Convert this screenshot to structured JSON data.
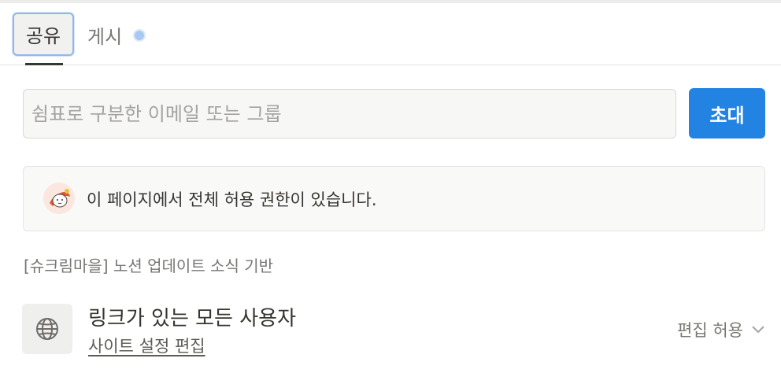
{
  "tabs": {
    "share_label": "공유",
    "publish_label": "게시",
    "publish_status_icon": "dot-icon"
  },
  "invite": {
    "placeholder": "쉼표로 구분한 이메일 또는 그룹",
    "value": "",
    "button_label": "초대"
  },
  "permission_notice": {
    "avatar_icon": "avatar-illustration",
    "text": "이 페이지에서 전체 허용 권한이 있습니다."
  },
  "workspace": {
    "name": "[슈크림마을] 노션 업데이트 소식 기반"
  },
  "link_access": {
    "icon": "globe-icon",
    "title": "링크가 있는 모든 사용자",
    "settings_link": "사이트 설정 편집",
    "permission_value": "편집 허용",
    "dropdown_icon": "chevron-down-icon"
  },
  "colors": {
    "accent": "#2383e2",
    "tab_focus": "#93b8e8",
    "text_primary": "#37352f",
    "text_secondary": "#787774"
  }
}
